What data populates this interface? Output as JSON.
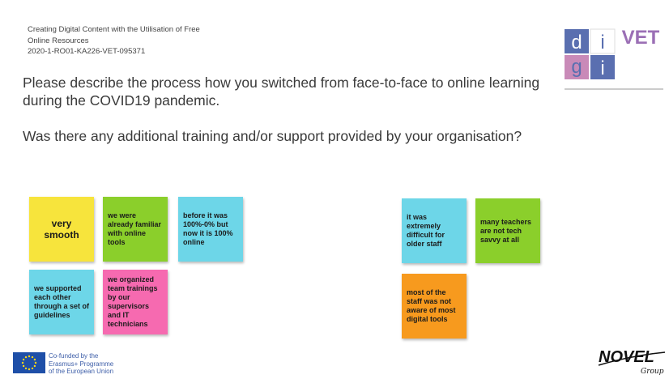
{
  "header": {
    "line1": "Creating Digital Content with the Utilisation of Free",
    "line2": "Online Resources",
    "line3": "2020-1-RO01-KA226-VET-095371"
  },
  "questions": {
    "q1": "Please describe the process how you switched from face-to-face to online learning during the COVID19 pandemic.",
    "q2": "Was there any additional training and/or support provided by your organisation?"
  },
  "logo": {
    "letters": [
      "d",
      "i",
      "g",
      "i"
    ],
    "suffix": "VET",
    "colors": {
      "blue": "#5a6fb0",
      "pink": "#c98ab8",
      "white": "#ffffff",
      "vet": "#9b6fb5"
    }
  },
  "notes": [
    {
      "text": "very smooth",
      "color": "yellow"
    },
    {
      "text": "we were already familiar with online tools",
      "color": "green"
    },
    {
      "text": "before it was 100%-0% but now it is 100% online",
      "color": "cyan"
    },
    {
      "text": "we supported each other through a set of guidelines",
      "color": "cyan"
    },
    {
      "text": "we organized team trainings by our supervisors and IT technicians",
      "color": "pink"
    },
    {
      "text": "it was extremely difficult for older staff",
      "color": "cyan"
    },
    {
      "text": "many teachers are not tech savvy at all",
      "color": "green"
    },
    {
      "text": "most of the staff was not aware of most digital tools",
      "color": "orange"
    }
  ],
  "footer": {
    "eu_line1": "Co-funded by the",
    "eu_line2": "Erasmus+ Programme",
    "eu_line3": "of the European Union",
    "novel_text": "NOVEL",
    "novel_sub": "Group"
  }
}
